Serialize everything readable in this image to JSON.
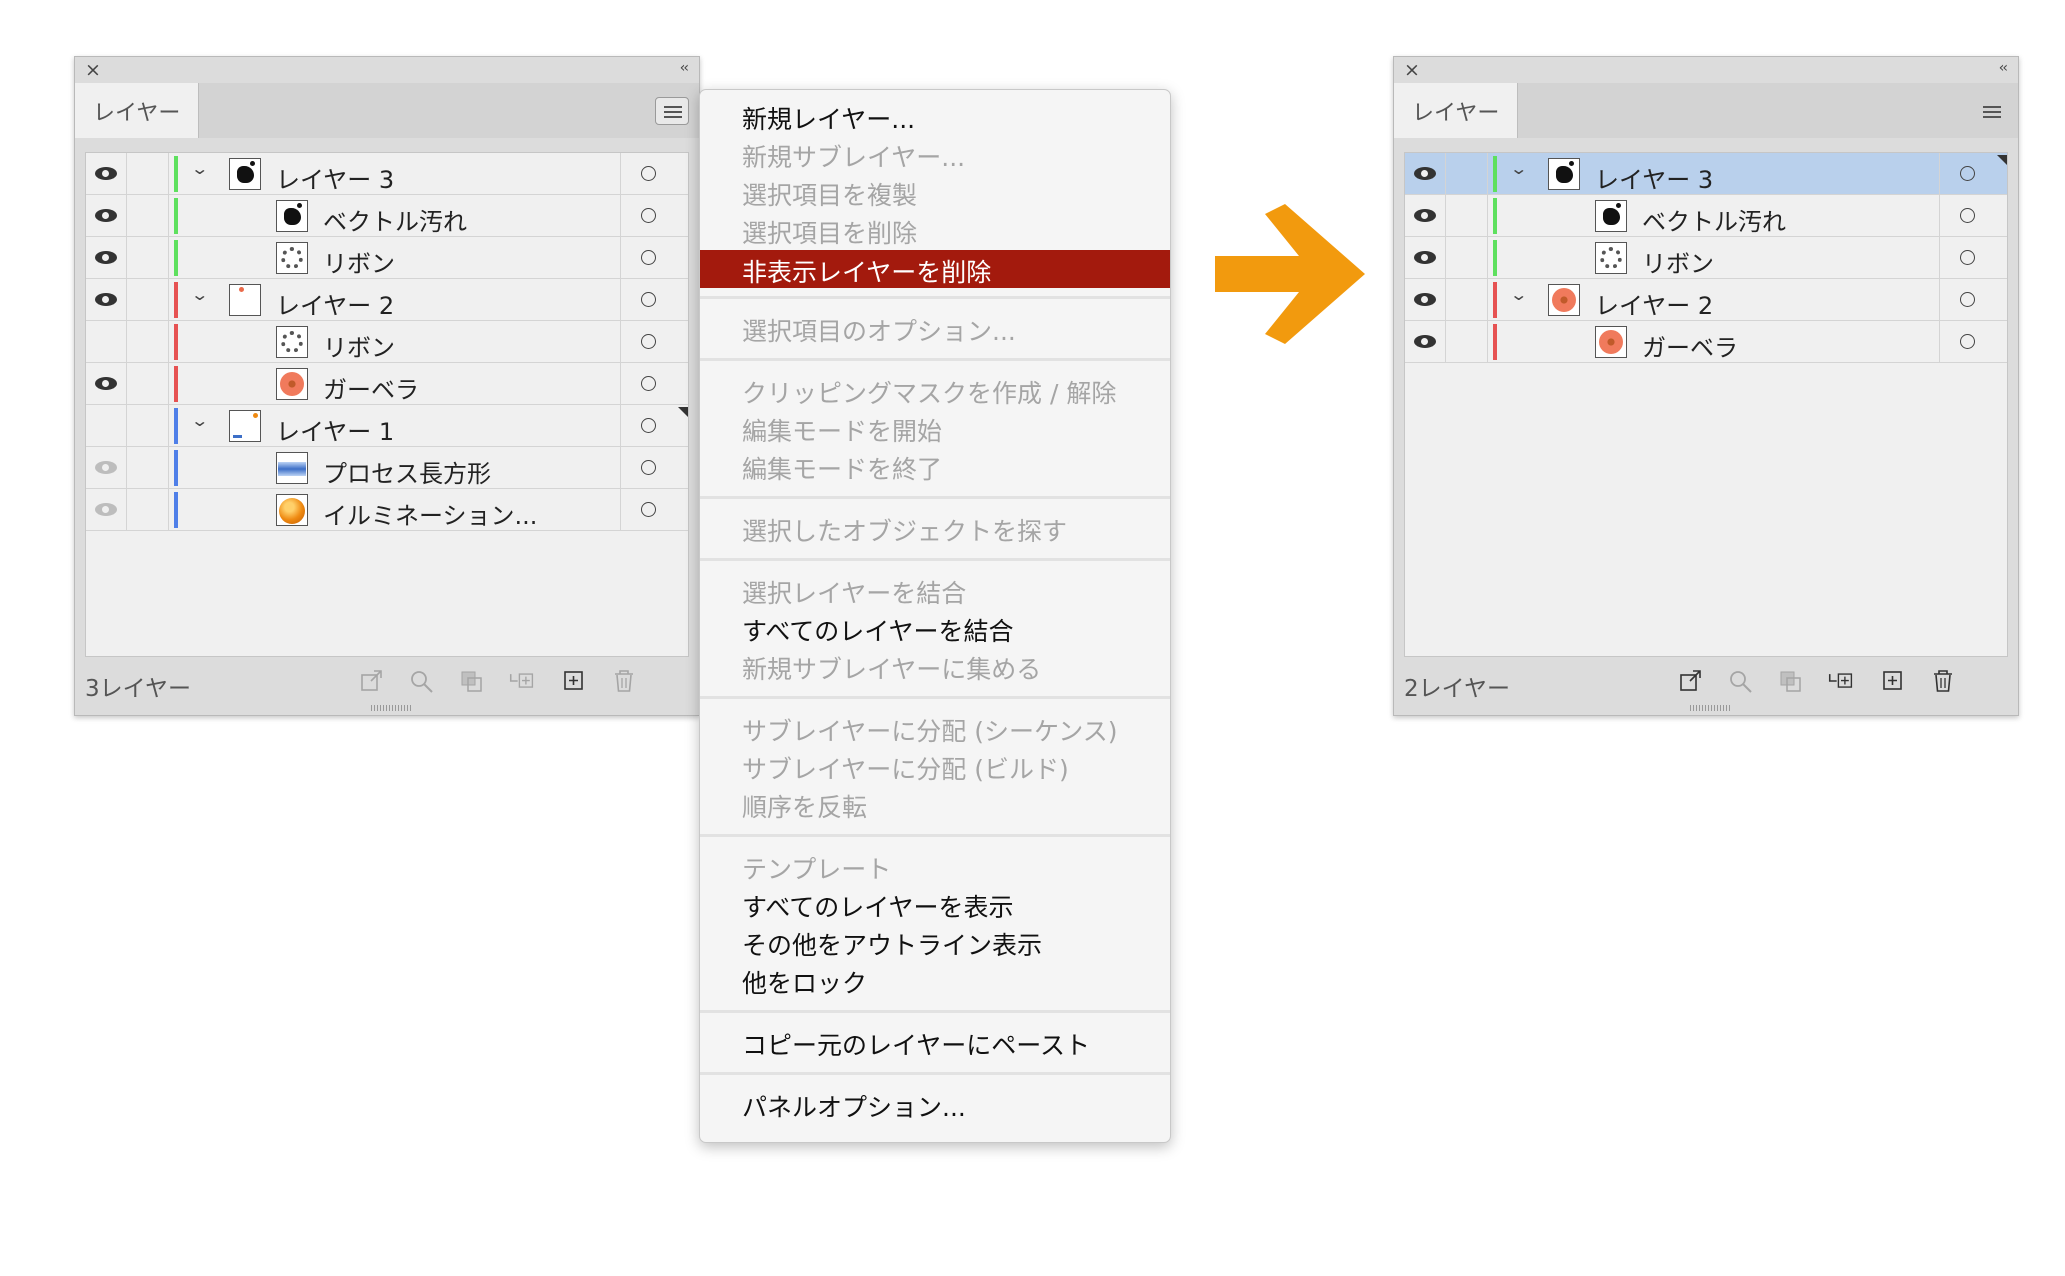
{
  "left_panel": {
    "tab_label": "レイヤー",
    "layer_count": "3レイヤー",
    "rows": [
      {
        "name": "レイヤー 3",
        "visible": true,
        "indent": 1,
        "color": "#5ee05e",
        "thumb": "splat-icon",
        "expander": true
      },
      {
        "name": "ベクトル汚れ",
        "visible": true,
        "indent": 2,
        "color": "#5ee05e",
        "thumb": "splat-icon"
      },
      {
        "name": "リボン",
        "visible": true,
        "indent": 2,
        "color": "#5ee05e",
        "thumb": "ribbon-icon"
      },
      {
        "name": "レイヤー 2",
        "visible": true,
        "indent": 1,
        "color": "#e65252",
        "thumb": "blank-icon",
        "expander": true
      },
      {
        "name": "リボン",
        "visible": false,
        "indent": 2,
        "color": "#e65252",
        "thumb": "ribbon-icon"
      },
      {
        "name": "ガーベラ",
        "visible": true,
        "indent": 2,
        "color": "#e65252",
        "thumb": "gerbera-icon"
      },
      {
        "name": "レイヤー 1",
        "visible": false,
        "indent": 1,
        "color": "#4f7fe8",
        "thumb": "blank-icon",
        "expander": true
      },
      {
        "name": "プロセス長方形",
        "visible": "dim",
        "indent": 2,
        "color": "#4f7fe8",
        "thumb": "gradient-rect-icon"
      },
      {
        "name": "イルミネーション...",
        "visible": "dim",
        "indent": 2,
        "color": "#4f7fe8",
        "thumb": "orb-icon"
      }
    ]
  },
  "right_panel": {
    "tab_label": "レイヤー",
    "layer_count": "2レイヤー",
    "rows": [
      {
        "name": "レイヤー 3",
        "visible": true,
        "indent": 1,
        "color": "#5ee05e",
        "thumb": "splat-icon",
        "expander": true,
        "selected": true
      },
      {
        "name": "ベクトル汚れ",
        "visible": true,
        "indent": 2,
        "color": "#5ee05e",
        "thumb": "splat-icon"
      },
      {
        "name": "リボン",
        "visible": true,
        "indent": 2,
        "color": "#5ee05e",
        "thumb": "ribbon-icon"
      },
      {
        "name": "レイヤー 2",
        "visible": true,
        "indent": 1,
        "color": "#e65252",
        "thumb": "gerbera-icon",
        "expander": true
      },
      {
        "name": "ガーベラ",
        "visible": true,
        "indent": 2,
        "color": "#e65252",
        "thumb": "gerbera-icon"
      }
    ]
  },
  "menu": {
    "items": [
      {
        "label": "新規レイヤー...",
        "enabled": true
      },
      {
        "label": "新規サブレイヤー...",
        "enabled": false
      },
      {
        "label": "選択項目を複製",
        "enabled": false
      },
      {
        "label": "選択項目を削除",
        "enabled": false
      },
      {
        "label": "非表示レイヤーを削除",
        "enabled": true,
        "highlighted": true
      },
      {
        "label": "選択項目のオプション...",
        "enabled": false
      },
      {
        "label": "クリッピングマスクを作成 / 解除",
        "enabled": false
      },
      {
        "label": "編集モードを開始",
        "enabled": false
      },
      {
        "label": "編集モードを終了",
        "enabled": false
      },
      {
        "label": "選択したオブジェクトを探す",
        "enabled": false
      },
      {
        "label": "選択レイヤーを結合",
        "enabled": false
      },
      {
        "label": "すべてのレイヤーを結合",
        "enabled": true
      },
      {
        "label": "新規サブレイヤーに集める",
        "enabled": false
      },
      {
        "label": "サブレイヤーに分配 (シーケンス)",
        "enabled": false
      },
      {
        "label": "サブレイヤーに分配 (ビルド)",
        "enabled": false
      },
      {
        "label": "順序を反転",
        "enabled": false
      },
      {
        "label": "テンプレート",
        "enabled": false
      },
      {
        "label": "すべてのレイヤーを表示",
        "enabled": true
      },
      {
        "label": "その他をアウトライン表示",
        "enabled": true
      },
      {
        "label": "他をロック",
        "enabled": true
      },
      {
        "label": "コピー元のレイヤーにペースト",
        "enabled": true
      },
      {
        "label": "パネルオプション...",
        "enabled": true
      }
    ],
    "highlight_color": "#a31a0d"
  },
  "arrow_color": "#f29a0e"
}
